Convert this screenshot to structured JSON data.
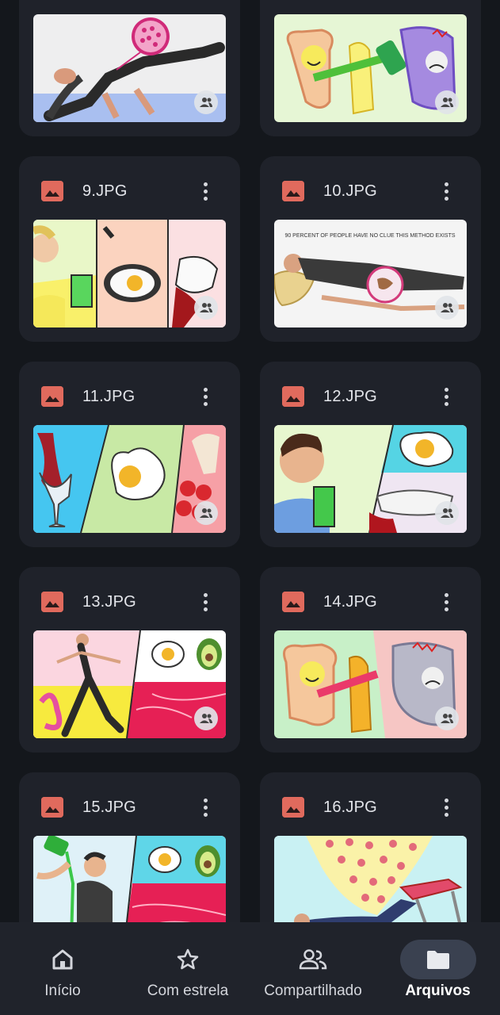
{
  "files": [
    {
      "name": "9.JPG"
    },
    {
      "name": "10.JPG",
      "caption": "90 PERCENT OF PEOPLE HAVE NO CLUE THIS METHOD EXISTS"
    },
    {
      "name": "11.JPG"
    },
    {
      "name": "12.JPG"
    },
    {
      "name": "13.JPG"
    },
    {
      "name": "14.JPG"
    },
    {
      "name": "15.JPG"
    },
    {
      "name": "16.JPG"
    }
  ],
  "nav": {
    "items": [
      {
        "label": "Início",
        "icon": "home-icon"
      },
      {
        "label": "Com estrela",
        "icon": "star-icon"
      },
      {
        "label": "Compartilhado",
        "icon": "people-icon"
      },
      {
        "label": "Arquivos",
        "icon": "folder-icon",
        "active": true
      }
    ]
  },
  "colors": {
    "background": "#14171c",
    "card": "#1f222a",
    "image_icon": "#e06a5d",
    "nav_bar": "#20232b",
    "active_pill": "#3a4150"
  }
}
